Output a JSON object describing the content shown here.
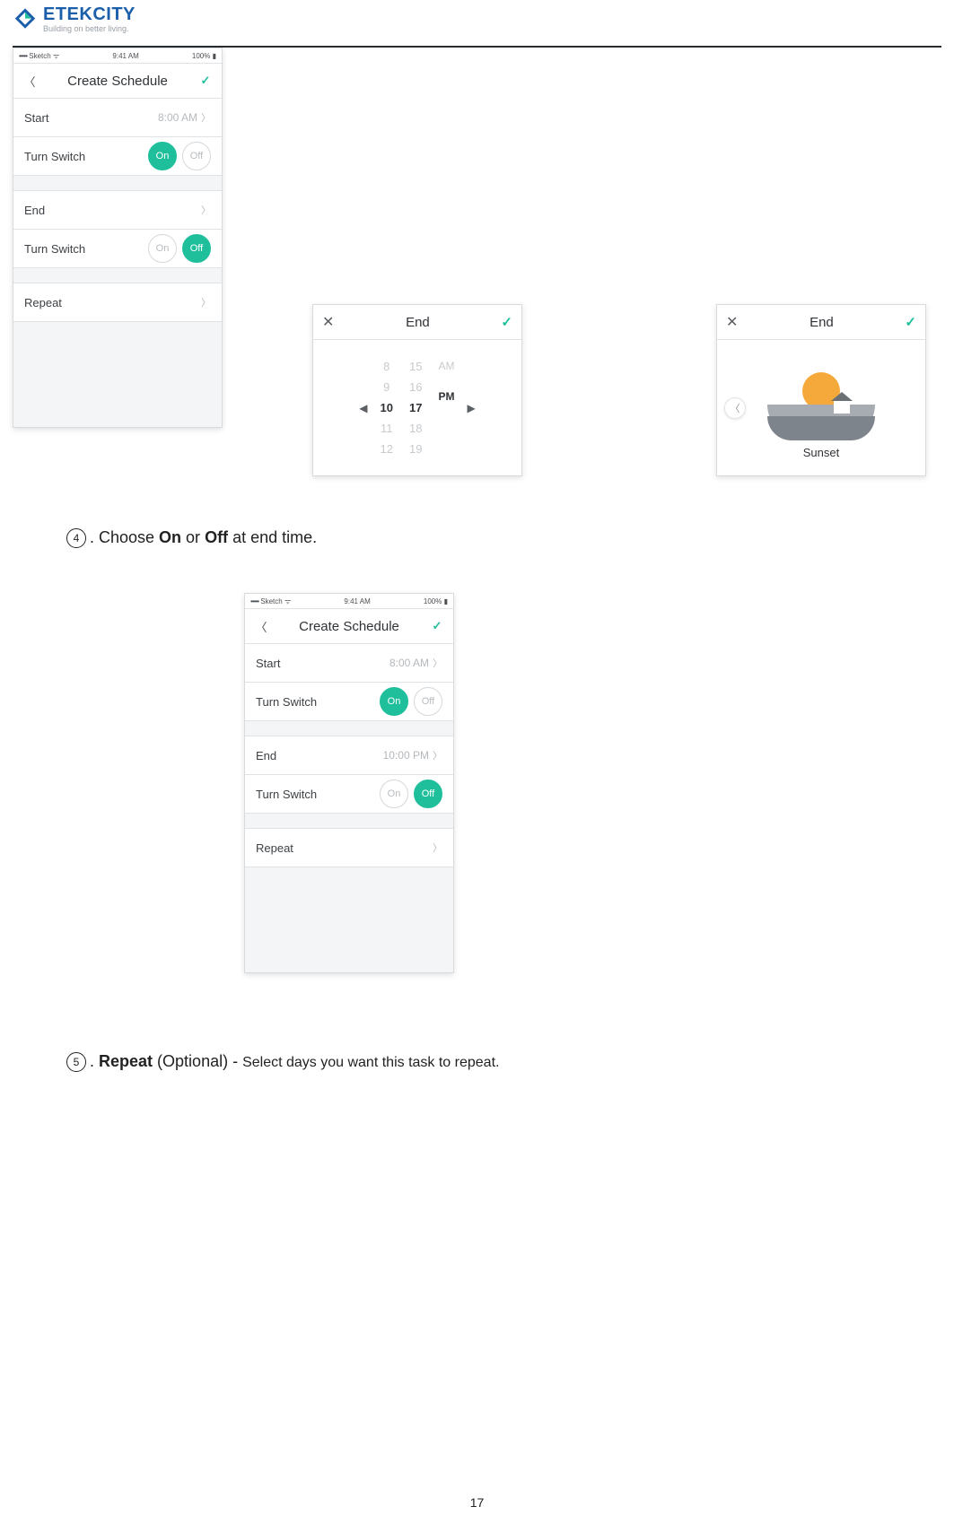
{
  "brand": {
    "name": "ETEKCITY",
    "tagline": "Building on better living."
  },
  "phone_status": {
    "carrier": "Sketch",
    "time": "9:41 AM",
    "battery": "100%"
  },
  "create_schedule": {
    "title": "Create Schedule",
    "start_label": "Start",
    "end_label": "End",
    "turn_switch_label": "Turn Switch",
    "repeat_label": "Repeat",
    "on": "On",
    "off": "Off"
  },
  "phone1": {
    "start_value": "8:00 AM",
    "end_value": ""
  },
  "phone2": {
    "start_value": "8:00 AM",
    "end_value": "10:00 PM"
  },
  "end_dialog": {
    "title": "End",
    "hours": [
      "8",
      "9",
      "10",
      "11",
      "12"
    ],
    "minutes": [
      "15",
      "16",
      "17",
      "18",
      "19"
    ],
    "ampm": [
      "AM",
      "PM"
    ],
    "sel_hour": "10",
    "sel_min": "17",
    "sel_ampm": "PM"
  },
  "sunset_dialog": {
    "title": "End",
    "label": "Sunset"
  },
  "steps": {
    "s4_num": "4",
    "s4_a": ". Choose ",
    "s4_b": "On",
    "s4_c": " or ",
    "s4_d": "Off",
    "s4_e": " at end time.",
    "s5_num": "5",
    "s5_a": ". ",
    "s5_b": "Repeat",
    "s5_c": " (Optional) - ",
    "s5_d": "Select days you want this task to repeat."
  },
  "page_number": "17"
}
